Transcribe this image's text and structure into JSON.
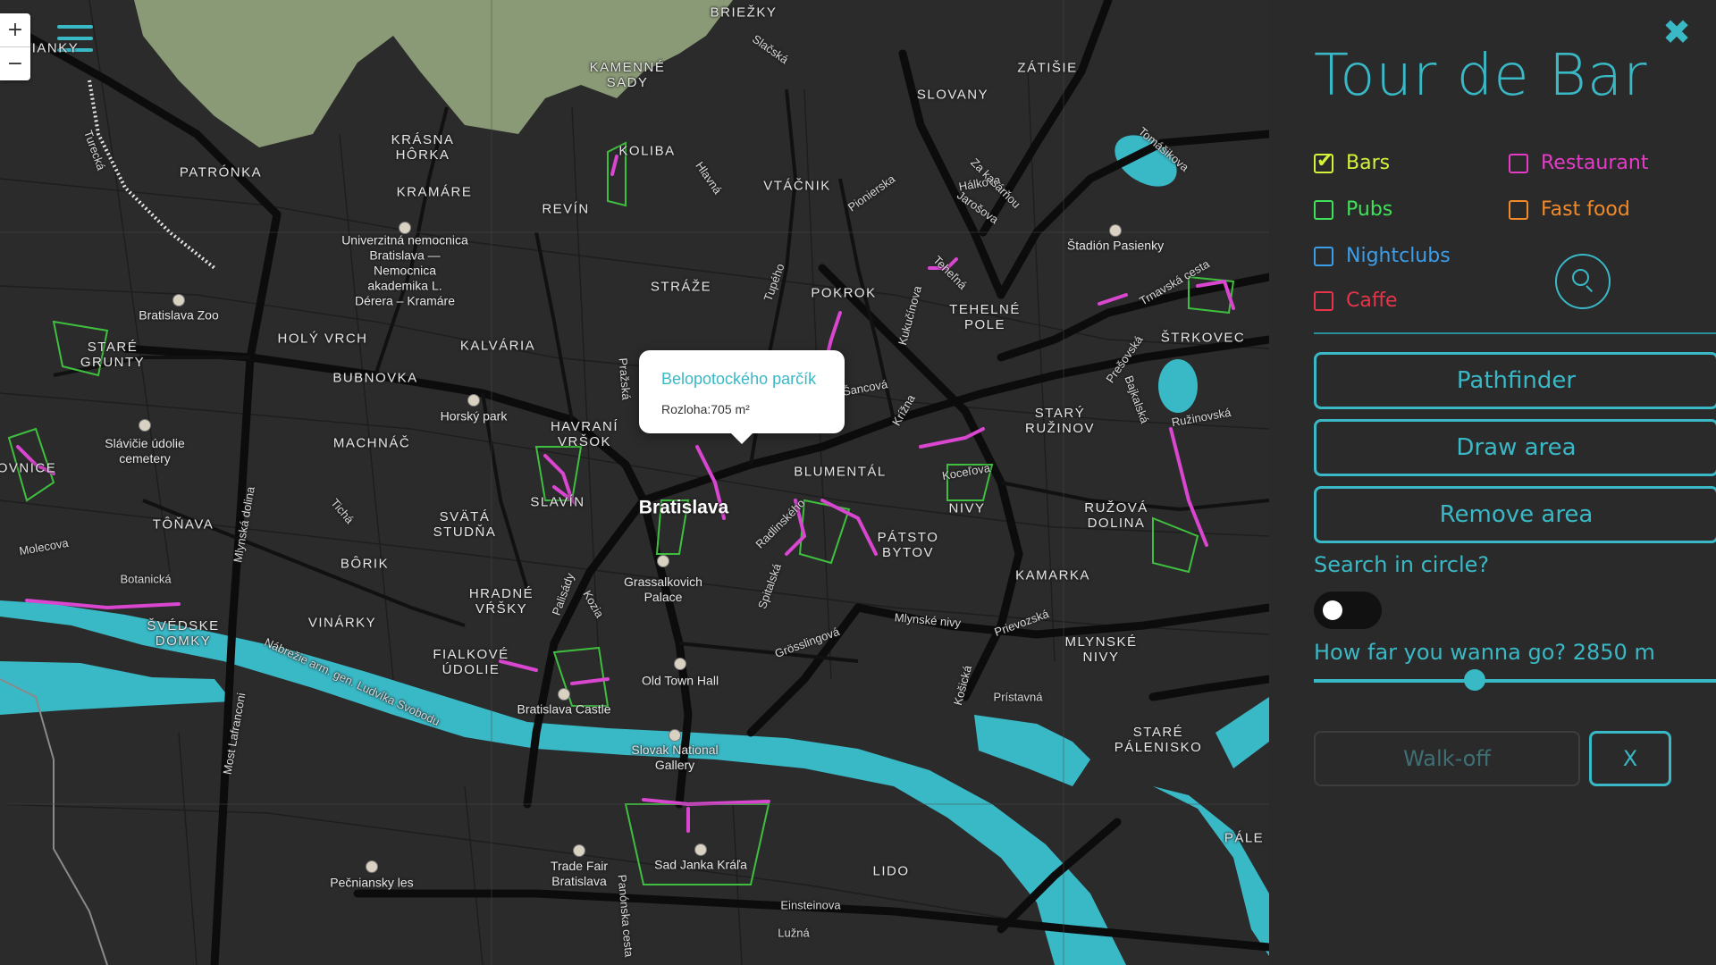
{
  "map": {
    "zoom_in": "+",
    "zoom_out": "−",
    "city": "Bratislava",
    "districts": [
      "BRIEŽKY",
      "KAMENNÉ\nSADY",
      "ZÁTIŠIE",
      "SLOVANY",
      "KRÁSNA\nHÔRKA",
      "PATRÓNKA",
      "KOLIBA",
      "VTÁČNIK",
      "KRAMÁRE",
      "REVÍN",
      "STRÁŽE",
      "POKROK",
      "TEHELNÉ\nPOLE",
      "ŠTRKOVEC",
      "HOLÝ VRCH",
      "KALVÁRIA",
      "BUBNOVKA",
      "STARÉ\nGRUNTY",
      "MACHNÁČ",
      "HAVRANÍ\nVRŠOK",
      "SLAVÍN",
      "BLUMENTÁL",
      "STARÝ\nRUŽINOV",
      "SVÄTÁ\nSTUDŇA",
      "NIVY",
      "RUŽOVÁ\nDOLINA",
      "TÔŇAVA",
      "PÁTSTO\nBYTOV",
      "KAMARKA",
      "BÔRIK",
      "HRADNÉ\nVŔŠKY",
      "VINÁRKY",
      "ŠVÉDSKE\nDOMKY",
      "FIALKOVÉ\nÚDOLIE",
      "MLYNSKÉ\nNIVY",
      "STARÉ\nPÁLENISKO",
      "LIDO",
      "IANKY",
      "OVNICE",
      "PÁLE"
    ],
    "pois": [
      "Univerzitná nemocnica\nBratislava —\nNemocnica\nakademika L.\nDérera – Kramáre",
      "Bratislava Zoo",
      "Horský park",
      "Slávičie údolie\ncemetery",
      "Štadión Pasienky",
      "Grassalkovich\nPalace",
      "Old Town Hall",
      "Bratislava Castle",
      "Slovak National\nGallery",
      "Trade Fair\nBratislava",
      "Sad Janka Kráľa",
      "Pečniansky les"
    ],
    "streets": [
      "Slačská",
      "Hálkova",
      "Tomášikova",
      "Za kasárňou",
      "Jarošova",
      "Pionierska",
      "Hlavná",
      "Tupého",
      "Teheľná",
      "Trnavská cesta",
      "Prešovská",
      "Bajkalská",
      "Ružinovská",
      "Kukučínova",
      "Šancová",
      "Krížna",
      "Pražská",
      "Radlinského",
      "Koceľova",
      "Molecova",
      "Botanická",
      "Tichá",
      "Mlynská dolina",
      "Most Lafranconi",
      "Nábrežie arm. gen. Ludvíka Svobodu",
      "Palisády",
      "Kozia",
      "Spitalská",
      "Mlynské nivy",
      "Prievozská",
      "Grösslingová",
      "Košická",
      "Prístavná",
      "Einsteinova",
      "Lužná",
      "Panónska cesta",
      "Turecká"
    ]
  },
  "popup": {
    "title": "Belopotockého parčík",
    "body": "Rozloha:705 m²"
  },
  "panel": {
    "close": "✖",
    "title": "Tour de Bar",
    "categories": [
      {
        "label": "Bars",
        "color": "#d4f23a",
        "checked": true
      },
      {
        "label": "Restaurant",
        "color": "#e43cc7",
        "checked": false
      },
      {
        "label": "Pubs",
        "color": "#3fe05a",
        "checked": false
      },
      {
        "label": "Fast food",
        "color": "#f08a2a",
        "checked": false
      },
      {
        "label": "Nightclubs",
        "color": "#3c9ee8",
        "checked": false
      },
      {
        "label": "Caffe",
        "color": "#e8344a",
        "checked": false
      }
    ],
    "pathfinder": "Pathfinder",
    "draw_area": "Draw area",
    "remove_area": "Remove area",
    "search_circle_label": "Search in circle?",
    "search_circle_on": false,
    "distance_label": "How far you wanna go? 2850 m",
    "distance_fraction": 0.4,
    "walkoff": "Walk-off",
    "clear": "X"
  },
  "colors": {
    "accent": "#39b8c6",
    "water": "#39b8c6",
    "forest": "#8a9a76",
    "map_bg": "#2b2b2b",
    "park": "#3fbf3f",
    "route": "#d946d0"
  }
}
